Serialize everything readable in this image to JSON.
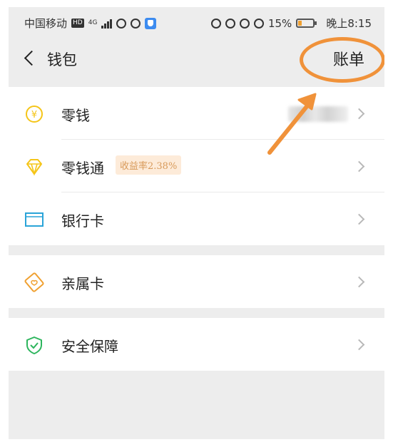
{
  "status_bar": {
    "carrier": "中国移动",
    "hd": "HD",
    "network": "4G",
    "battery": "15%",
    "time": "晚上8:15"
  },
  "header": {
    "title": "钱包",
    "bill": "账单"
  },
  "groups": [
    {
      "items": [
        {
          "label": "零钱",
          "icon": "yuan-coin-icon",
          "color": "#f5c518"
        },
        {
          "label": "零钱通",
          "icon": "diamond-icon",
          "color": "#f5c518",
          "badge": "收益率2.38%"
        },
        {
          "label": "银行卡",
          "icon": "card-icon",
          "color": "#2aa4d8"
        }
      ]
    },
    {
      "items": [
        {
          "label": "亲属卡",
          "icon": "family-card-icon",
          "color": "#f0a030"
        }
      ]
    },
    {
      "items": [
        {
          "label": "安全保障",
          "icon": "shield-icon",
          "color": "#2db55d"
        }
      ]
    }
  ],
  "annotation": {
    "color": "#f0923a"
  }
}
